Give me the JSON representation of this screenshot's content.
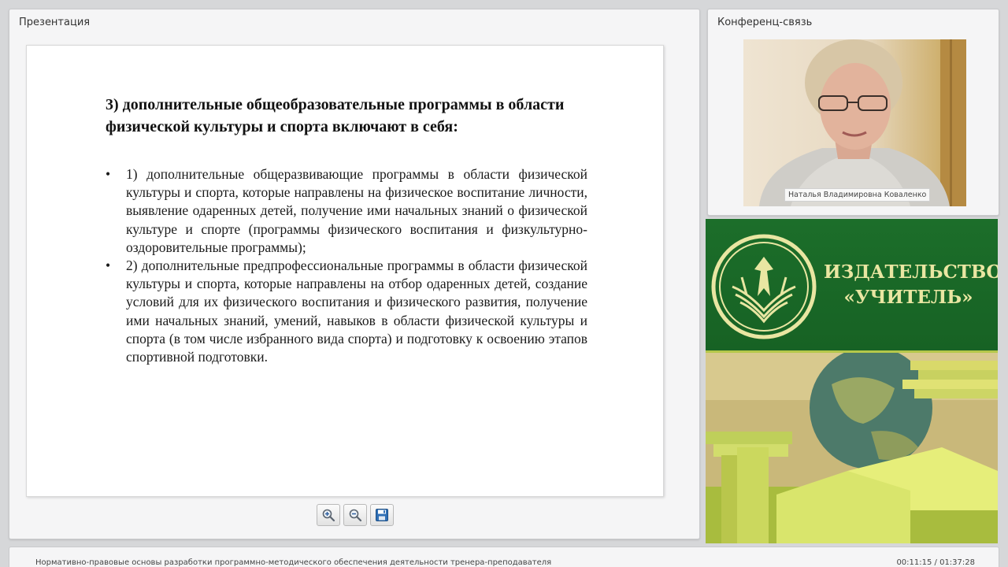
{
  "presentation": {
    "panel_title": "Презентация",
    "slide": {
      "heading": "3) дополнительные общеобразовательные программы в области физической культуры и спорта включают в себя:",
      "bullets": [
        "1) дополнительные общеразвивающие программы в области физической культуры и спорта, которые направлены на физическое воспитание личности, выявление одаренных детей, получение ими начальных знаний о физической культуре и спорте (программы физического воспитания и физкультурно-оздоровительные программы);",
        "2) дополнительные предпрофессиональные программы в области физической культуры и спорта, которые направлены на отбор одаренных детей, создание условий для их физического воспитания и физического развития, получение ими начальных знаний, умений, навыков в области физической культуры и спорта (в том числе избранного вида спорта) и подготовку к освоению этапов спортивной подготовки."
      ],
      "bullet_symbol": "•"
    },
    "toolbar": {
      "zoom_in_icon": "zoom-in-icon",
      "zoom_out_icon": "zoom-out-icon",
      "save_icon": "save-icon"
    }
  },
  "conference": {
    "panel_title": "Конференц-связь",
    "speaker_name": "Наталья Владимировна Коваленко"
  },
  "banner": {
    "title_line1": "ИЗДАТЕЛЬСТВО",
    "title_line2": "«УЧИТЕЛЬ»",
    "colors": {
      "green": "#1c6e2a",
      "text": "#e9e6a2",
      "accent": "#b5c84a"
    }
  },
  "footer": {
    "title": "Нормативно-правовые основы разработки программно-методического обеспечения деятельности тренера-преподавателя",
    "time": "00:11:15 / 01:37:28"
  }
}
